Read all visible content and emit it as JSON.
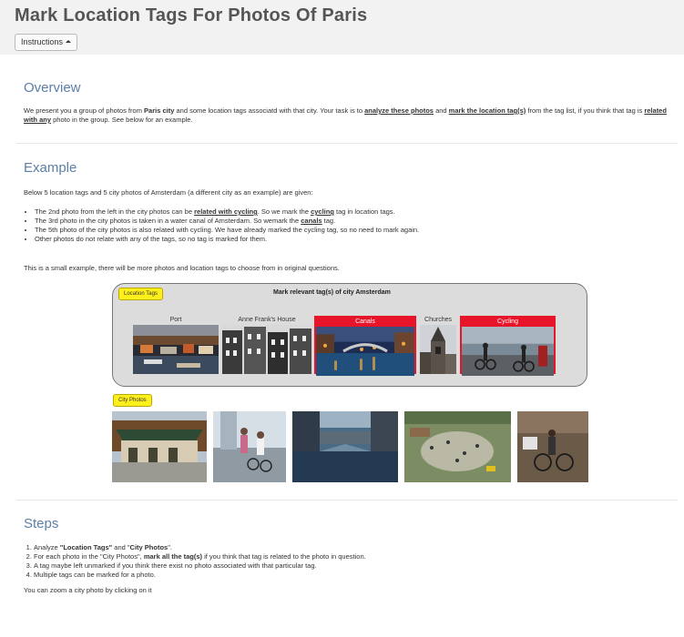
{
  "header": {
    "title": "Mark Location Tags For Photos Of Paris",
    "instructions_label": "Instructions"
  },
  "overview": {
    "heading": "Overview",
    "t1": "We present you a group of photos from ",
    "city": "Paris city",
    "t2": " and some location tags associatd with that city. Your task is to ",
    "analyze": "analyze these photos",
    "t3": " and ",
    "mark": "mark the location tag(s)",
    "t4": " from the tag list, if you think that tag is ",
    "related": "related with any",
    "t5": " photo in the group. See below for an example."
  },
  "example": {
    "heading": "Example",
    "intro": "Below 5 location tags and 5 city photos of Amsterdam (a different city as an example) are given:",
    "b1_a": "The 2nd photo from the left in the city photos can be ",
    "b1_u": "related with cycling",
    "b1_b": ". So we mark the ",
    "b1_u2": "cycling",
    "b1_c": " tag in location tags.",
    "b2_a": "The 3rd photo in the city photos is taken in a water canal of Amsterdam. So wemark the ",
    "b2_u": "canals",
    "b2_b": " tag.",
    "b3": "The 5th photo of the city photos is also related with cycling. We have already marked the cycling tag, so no need to mark again.",
    "b4": "Other photos do not relate with any of the tags, so no tag is marked for them.",
    "note": "This is a small example, there will be more photos and location tags to choose from in original questions.",
    "location_tags_label": "Location Tags",
    "figure_title": "Mark relevant tag(s) of city Amsterdam",
    "tags": [
      "Port",
      "Anne Frank's House",
      "Canals",
      "Churches",
      "Cycling"
    ],
    "city_photos_label": "City Photos"
  },
  "steps": {
    "heading": "Steps",
    "s1_a": "Analyze ",
    "s1_b": "\"Location Tags\"",
    "s1_c": " and \"",
    "s1_d": "City Photos",
    "s1_e": "\".",
    "s2_a": "For each photo in the \"City Photos\", ",
    "s2_b": "mark all the tag(s)",
    "s2_c": " if you think that tag is related to the photo in question.",
    "s3": "A tag maybe left unmarked if you think there exist no photo associated with that particular tag.",
    "s4": "Multiple tags can be marked for a photo.",
    "zoom_note": "You can zoom a city photo by clicking on it"
  },
  "colors": {
    "heading": "#5b7fa8",
    "mark_red": "#e8152a",
    "label_yellow": "#ffef1a"
  }
}
